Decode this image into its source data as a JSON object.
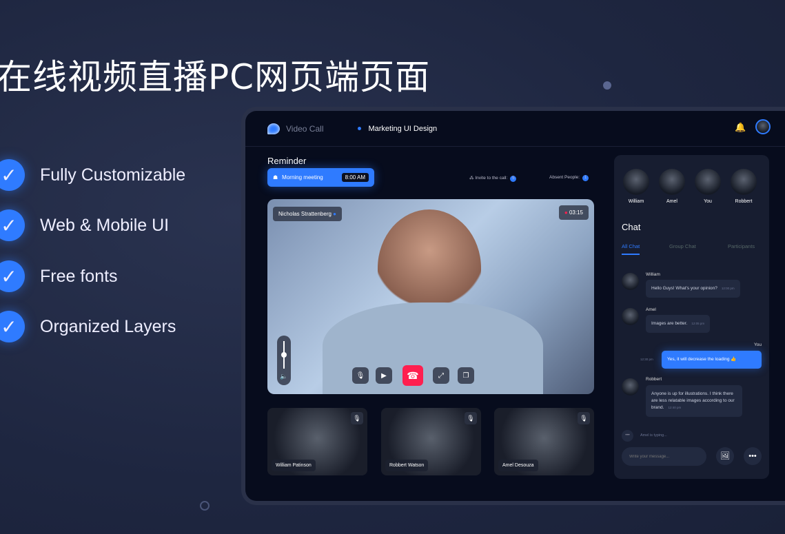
{
  "headline": "在线视频直播PC网页端页面",
  "features": [
    "Fully Customizable",
    "Web & Mobile UI",
    "Free fonts",
    "Organized Layers"
  ],
  "app": {
    "name": "Video Call",
    "meeting_title": "Marketing UI Design"
  },
  "reminder": {
    "heading": "Reminder",
    "event": "Morning meeting",
    "time": "8:00 AM"
  },
  "invite": {
    "label": "Invite to the call:",
    "count": "5"
  },
  "absent": {
    "label": "Absent People:",
    "count": "1"
  },
  "main_video": {
    "speaker": "Nicholas Strattenberg",
    "timer": "03:15"
  },
  "thumbnails": [
    {
      "name": "William Patinson"
    },
    {
      "name": "Robbert Watson"
    },
    {
      "name": "Amel Desouza"
    }
  ],
  "participants": [
    "William",
    "Amel",
    "You",
    "Robbert"
  ],
  "chat": {
    "heading": "Chat",
    "tabs": [
      "All Chat",
      "Group Chat",
      "Participants"
    ],
    "messages": [
      {
        "sender": "William",
        "text": "Hello Guys! What's your opinion?",
        "time": "12:00 pm"
      },
      {
        "sender": "Amel",
        "text": "Images are better.",
        "time": "12:05 pm"
      },
      {
        "sender": "You",
        "text": "Yes, it will decrease the loading 👍",
        "time": "12:30 pm"
      },
      {
        "sender": "Robbert",
        "text": "Anyone is up for illustrations. I think there are less relatable images according to our brand.",
        "time": "12:40 pm"
      }
    ],
    "typing": "Amel is typing...",
    "placeholder": "Write your message..."
  },
  "colors": {
    "accent": "#2f7bff",
    "end_call": "#ff1f4f",
    "background": "#1e2640"
  }
}
